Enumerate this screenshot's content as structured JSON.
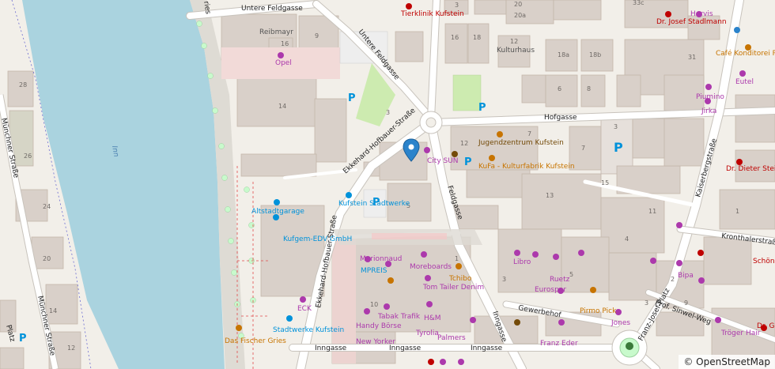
{
  "colors": {
    "background": "#f2efe9",
    "water": "#aad3df",
    "building": "#d9d0c9",
    "building_stroke": "#c4b6ab",
    "road": "#ffffff",
    "road_casing": "#c8c3bc",
    "pedestrian": "#ddd9d3",
    "park": "#c8facc",
    "grass": "#cdebb0",
    "marker": "#2b83cb",
    "shop": "#ac39ac",
    "food": "#c77400",
    "health": "#bf0000",
    "transport": "#0092da",
    "amenity": "#734a08"
  },
  "streets": {
    "untere_feldgasse_top": "Untere Feldgasse",
    "untere_feldgasse_vertical": "Untere Feldgasse",
    "hofgasse": "Hofgasse",
    "ekkehard_top": "Ekkehard-Hofbauer-Straße",
    "ekkehard_bottom": "Ekkehard-Hofbauer-Straße",
    "feldgasse": "Feldgasse",
    "kaiserbergstrasse": "Kaiserbergstraße",
    "kronthalerstrasse": "Kronthalerstraße",
    "prof_sinwel_weg": "Prof. Sinwel-Weg",
    "franz_josef_platz": "Franz-Josef-Platz",
    "gewerbehof": "Gewerbehof",
    "inngasse_horizontal": "Inngasse",
    "inngasse_vertical": "Inngasse",
    "muenchner_strasse_left": "Münchner Straße",
    "muenchner_strasse_bottom": "Münchner Straße",
    "platz_fragment": "Platz",
    "ries_fragment": "ries",
    "inn_river": "Inn"
  },
  "pois": {
    "tierklinik": "Tierklinik Kufstein",
    "hervis": "Hervis",
    "dr_stadlmann": "Dr. Josef Stadlmann",
    "cafe_riehle": "Café Konditorei Riehle",
    "eutel": "Eutel",
    "piumino": "Piumino",
    "jirka": "Jirka",
    "dr_steinmassl": "Dr. Dieter Steinmaßl",
    "reibmayr": "Reibmayr",
    "opel": "Opel",
    "kulturhaus": "Kulturhaus",
    "jugendzentrum": "Jugendzentrum Kufstein",
    "city_sun": "City SUN",
    "kufa": "KuFa - Kulturfabrik Kufstein",
    "altstadtgarage": "Altstadtgarage",
    "kufstein_stadtwerke": "Kufstein Stadtwerke",
    "kufgem": "Kufgem-EDV GmbH",
    "eck": "ECK",
    "stadtwerke_kufstein": "Stadtwerke Kufstein",
    "das_fischer": "Das Fischer Gries",
    "marionnaud": "Marionnaud",
    "moreboards": "Moreboards",
    "mpreis": "MPREIS",
    "tom_tailer": "Tom Tailer Denim",
    "tchibo": "Tchibo",
    "libro": "Libro",
    "ruetz": "Ruetz",
    "eurospar": "Eurospar",
    "tabak_trafik": "Tabak Trafik",
    "hm": "H&M",
    "tyrolia": "Tyrolia",
    "handy_boerse": "Handy Börse",
    "new_yorker": "New Yorker",
    "palmers": "Palmers",
    "pirmo_pick": "Pirmo Pick",
    "franz_eder": "Franz Eder",
    "jones": "Jones",
    "bipa": "Bipa",
    "troeger_hair": "Tröger Hair",
    "schoenes_harald": "Schöni Harald",
    "dr_gr_fragment": "Dr. Gr Her"
  },
  "house_numbers": [
    "33c",
    "20",
    "20a",
    "3",
    "16",
    "18",
    "12",
    "18a",
    "18b",
    "31",
    "9",
    "16",
    "28",
    "14",
    "3",
    "6",
    "8",
    "12",
    "7",
    "3",
    "1",
    "5",
    "13",
    "11",
    "26",
    "24",
    "20",
    "14",
    "15",
    "12",
    "10",
    "1",
    "3",
    "5",
    "4",
    "2",
    "3",
    "9",
    "1",
    "7"
  ],
  "attribution": "© OpenStreetMap"
}
